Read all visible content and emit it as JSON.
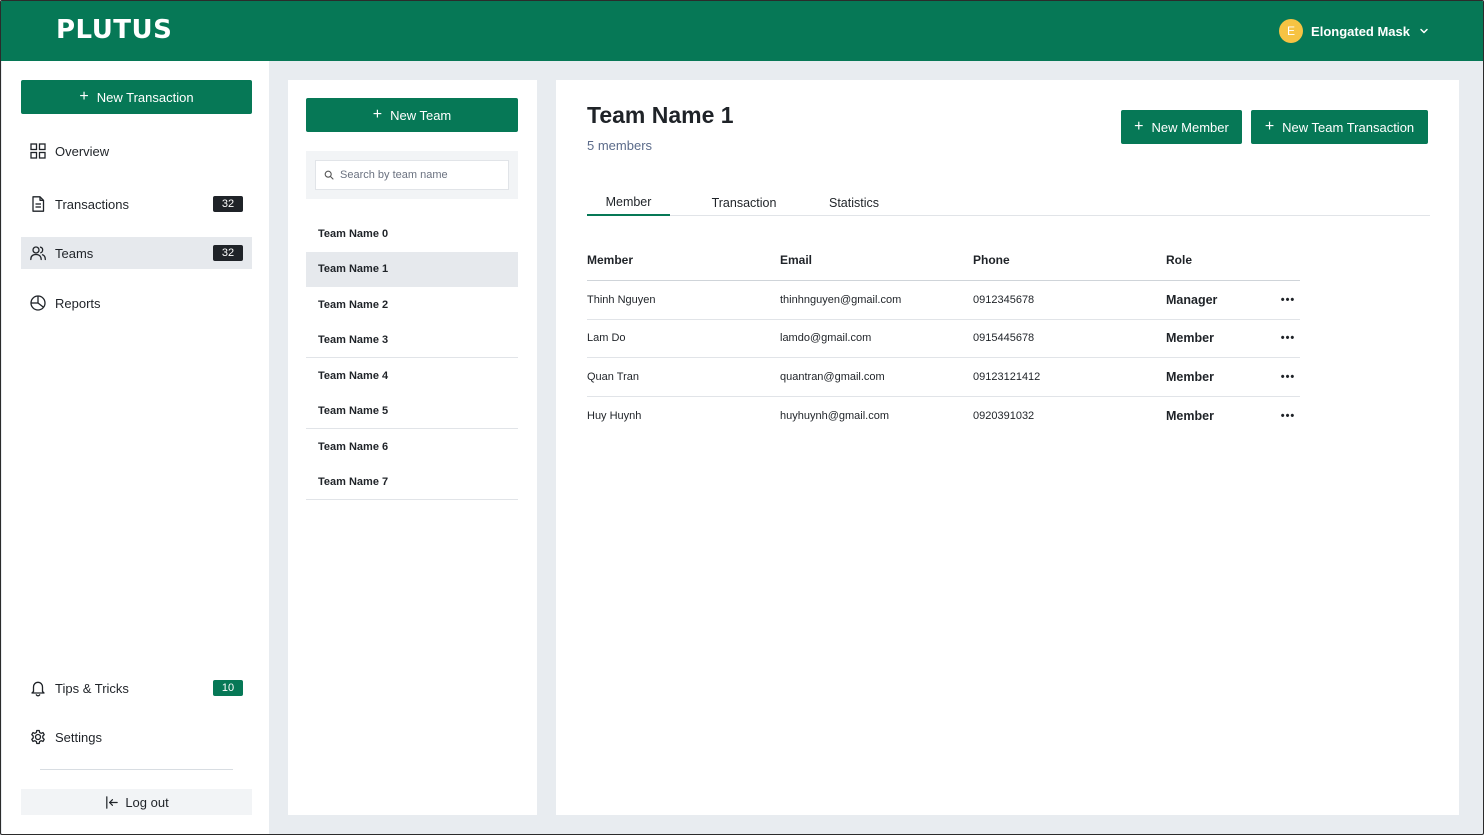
{
  "app": {
    "logo": "PLUTUS"
  },
  "user": {
    "initial": "E",
    "name": "Elongated Mask"
  },
  "sidebar": {
    "new_transaction_label": "New Transaction",
    "items": [
      {
        "label": "Overview",
        "icon": "grid-icon"
      },
      {
        "label": "Transactions",
        "icon": "document-icon",
        "badge": "32"
      },
      {
        "label": "Teams",
        "icon": "users-icon",
        "badge": "32",
        "active": true
      },
      {
        "label": "Reports",
        "icon": "pie-chart-icon"
      }
    ],
    "bottom_items": [
      {
        "label": "Tips & Tricks",
        "icon": "bell-icon",
        "badge": "10"
      },
      {
        "label": "Settings",
        "icon": "gear-icon"
      }
    ],
    "logout_label": "Log out"
  },
  "teams_panel": {
    "new_team_label": "New Team",
    "search_placeholder": "Search by team name",
    "teams": [
      "Team Name 0",
      "Team Name 1",
      "Team Name 2",
      "Team Name 3",
      "Team Name 4",
      "Team Name 5",
      "Team Name 6",
      "Team Name 7"
    ],
    "selected_index": 1
  },
  "main": {
    "title": "Team Name 1",
    "subtitle": "5 members",
    "new_member_label": "New Member",
    "new_team_transaction_label": "New Team Transaction",
    "tabs": [
      "Member",
      "Transaction",
      "Statistics"
    ],
    "active_tab": 0,
    "table": {
      "headers": [
        "Member",
        "Email",
        "Phone",
        "Role"
      ],
      "rows": [
        {
          "member": "Thinh Nguyen",
          "email": "thinhnguyen@gmail.com",
          "phone": "0912345678",
          "role": "Manager"
        },
        {
          "member": "Lam Do",
          "email": "lamdo@gmail.com",
          "phone": "0915445678",
          "role": "Member"
        },
        {
          "member": "Quan Tran",
          "email": "quantran@gmail.com",
          "phone": "09123121412",
          "role": "Member"
        },
        {
          "member": "Huy Huynh",
          "email": "huyhuynh@gmail.com",
          "phone": "0920391032",
          "role": "Member"
        }
      ]
    }
  },
  "colors": {
    "brand": "#067856",
    "avatar": "#f6c343",
    "background": "#e8ecf0",
    "active_item": "#e6e9ed"
  }
}
